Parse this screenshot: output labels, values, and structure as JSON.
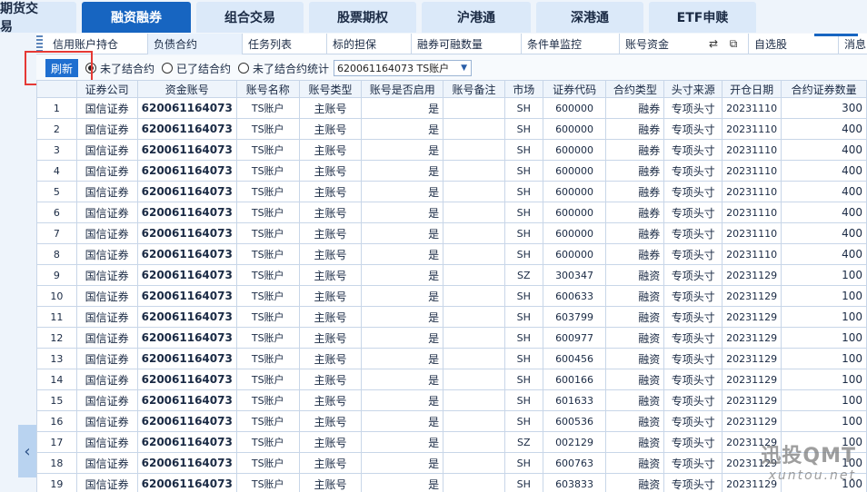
{
  "top_tabs": [
    "期货交易",
    "融资融券",
    "组合交易",
    "股票期权",
    "沪港通",
    "深港通",
    "ETF申赎"
  ],
  "active_top_tab": "融资融券",
  "sub_tabs": [
    "信用账户持仓",
    "负债合约",
    "任务列表",
    "标的担保",
    "融券可融数量",
    "条件单监控",
    "账号资金",
    "自选股",
    "消息"
  ],
  "active_sub_tab": "负债合约",
  "toolbar": {
    "refresh_label": "刷新",
    "radio_options": [
      "未了结合约",
      "已了结合约",
      "未了结合约统计"
    ],
    "selected_radio": "未了结合约",
    "account_value": "620061164073 TS账户"
  },
  "table": {
    "columns": [
      "",
      "证券公司",
      "资金账号",
      "账号名称",
      "账号类型",
      "账号是否启用",
      "账号备注",
      "市场",
      "证券代码",
      "合约类型",
      "头寸来源",
      "开仓日期",
      "合约证券数量"
    ],
    "rows": [
      [
        "1",
        "国信证券",
        "620061164073",
        "TS账户",
        "主账号",
        "是",
        "",
        "SH",
        "600000",
        "融券",
        "专项头寸",
        "20231110",
        "300"
      ],
      [
        "2",
        "国信证券",
        "620061164073",
        "TS账户",
        "主账号",
        "是",
        "",
        "SH",
        "600000",
        "融券",
        "专项头寸",
        "20231110",
        "400"
      ],
      [
        "3",
        "国信证券",
        "620061164073",
        "TS账户",
        "主账号",
        "是",
        "",
        "SH",
        "600000",
        "融券",
        "专项头寸",
        "20231110",
        "400"
      ],
      [
        "4",
        "国信证券",
        "620061164073",
        "TS账户",
        "主账号",
        "是",
        "",
        "SH",
        "600000",
        "融券",
        "专项头寸",
        "20231110",
        "400"
      ],
      [
        "5",
        "国信证券",
        "620061164073",
        "TS账户",
        "主账号",
        "是",
        "",
        "SH",
        "600000",
        "融券",
        "专项头寸",
        "20231110",
        "400"
      ],
      [
        "6",
        "国信证券",
        "620061164073",
        "TS账户",
        "主账号",
        "是",
        "",
        "SH",
        "600000",
        "融券",
        "专项头寸",
        "20231110",
        "400"
      ],
      [
        "7",
        "国信证券",
        "620061164073",
        "TS账户",
        "主账号",
        "是",
        "",
        "SH",
        "600000",
        "融券",
        "专项头寸",
        "20231110",
        "400"
      ],
      [
        "8",
        "国信证券",
        "620061164073",
        "TS账户",
        "主账号",
        "是",
        "",
        "SH",
        "600000",
        "融券",
        "专项头寸",
        "20231110",
        "400"
      ],
      [
        "9",
        "国信证券",
        "620061164073",
        "TS账户",
        "主账号",
        "是",
        "",
        "SZ",
        "300347",
        "融资",
        "专项头寸",
        "20231129",
        "100"
      ],
      [
        "10",
        "国信证券",
        "620061164073",
        "TS账户",
        "主账号",
        "是",
        "",
        "SH",
        "600633",
        "融资",
        "专项头寸",
        "20231129",
        "100"
      ],
      [
        "11",
        "国信证券",
        "620061164073",
        "TS账户",
        "主账号",
        "是",
        "",
        "SH",
        "603799",
        "融资",
        "专项头寸",
        "20231129",
        "100"
      ],
      [
        "12",
        "国信证券",
        "620061164073",
        "TS账户",
        "主账号",
        "是",
        "",
        "SH",
        "600977",
        "融资",
        "专项头寸",
        "20231129",
        "100"
      ],
      [
        "13",
        "国信证券",
        "620061164073",
        "TS账户",
        "主账号",
        "是",
        "",
        "SH",
        "600456",
        "融资",
        "专项头寸",
        "20231129",
        "100"
      ],
      [
        "14",
        "国信证券",
        "620061164073",
        "TS账户",
        "主账号",
        "是",
        "",
        "SH",
        "600166",
        "融资",
        "专项头寸",
        "20231129",
        "100"
      ],
      [
        "15",
        "国信证券",
        "620061164073",
        "TS账户",
        "主账号",
        "是",
        "",
        "SH",
        "601633",
        "融资",
        "专项头寸",
        "20231129",
        "100"
      ],
      [
        "16",
        "国信证券",
        "620061164073",
        "TS账户",
        "主账号",
        "是",
        "",
        "SH",
        "600536",
        "融资",
        "专项头寸",
        "20231129",
        "100"
      ],
      [
        "17",
        "国信证券",
        "620061164073",
        "TS账户",
        "主账号",
        "是",
        "",
        "SZ",
        "002129",
        "融资",
        "专项头寸",
        "20231129",
        "100"
      ],
      [
        "18",
        "国信证券",
        "620061164073",
        "TS账户",
        "主账号",
        "是",
        "",
        "SH",
        "600763",
        "融资",
        "专项头寸",
        "20231129",
        "100"
      ],
      [
        "19",
        "国信证券",
        "620061164073",
        "TS账户",
        "主账号",
        "是",
        "",
        "SH",
        "603833",
        "融资",
        "专项头寸",
        "20231129",
        "100"
      ]
    ]
  },
  "watermark": {
    "main": "迅投QMT",
    "sub": "xuntou.net"
  },
  "colors": {
    "accent": "#1765c1",
    "highlight_box": "#e53935"
  }
}
